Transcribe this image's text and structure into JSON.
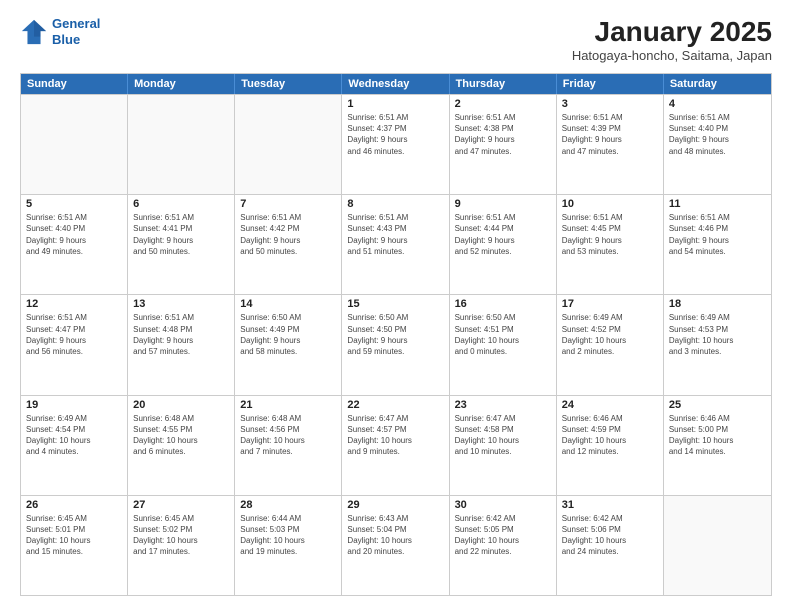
{
  "header": {
    "logo_line1": "General",
    "logo_line2": "Blue",
    "main_title": "January 2025",
    "subtitle": "Hatogaya-honcho, Saitama, Japan"
  },
  "weekdays": [
    "Sunday",
    "Monday",
    "Tuesday",
    "Wednesday",
    "Thursday",
    "Friday",
    "Saturday"
  ],
  "weeks": [
    [
      {
        "day": "",
        "info": ""
      },
      {
        "day": "",
        "info": ""
      },
      {
        "day": "",
        "info": ""
      },
      {
        "day": "1",
        "info": "Sunrise: 6:51 AM\nSunset: 4:37 PM\nDaylight: 9 hours\nand 46 minutes."
      },
      {
        "day": "2",
        "info": "Sunrise: 6:51 AM\nSunset: 4:38 PM\nDaylight: 9 hours\nand 47 minutes."
      },
      {
        "day": "3",
        "info": "Sunrise: 6:51 AM\nSunset: 4:39 PM\nDaylight: 9 hours\nand 47 minutes."
      },
      {
        "day": "4",
        "info": "Sunrise: 6:51 AM\nSunset: 4:40 PM\nDaylight: 9 hours\nand 48 minutes."
      }
    ],
    [
      {
        "day": "5",
        "info": "Sunrise: 6:51 AM\nSunset: 4:40 PM\nDaylight: 9 hours\nand 49 minutes."
      },
      {
        "day": "6",
        "info": "Sunrise: 6:51 AM\nSunset: 4:41 PM\nDaylight: 9 hours\nand 50 minutes."
      },
      {
        "day": "7",
        "info": "Sunrise: 6:51 AM\nSunset: 4:42 PM\nDaylight: 9 hours\nand 50 minutes."
      },
      {
        "day": "8",
        "info": "Sunrise: 6:51 AM\nSunset: 4:43 PM\nDaylight: 9 hours\nand 51 minutes."
      },
      {
        "day": "9",
        "info": "Sunrise: 6:51 AM\nSunset: 4:44 PM\nDaylight: 9 hours\nand 52 minutes."
      },
      {
        "day": "10",
        "info": "Sunrise: 6:51 AM\nSunset: 4:45 PM\nDaylight: 9 hours\nand 53 minutes."
      },
      {
        "day": "11",
        "info": "Sunrise: 6:51 AM\nSunset: 4:46 PM\nDaylight: 9 hours\nand 54 minutes."
      }
    ],
    [
      {
        "day": "12",
        "info": "Sunrise: 6:51 AM\nSunset: 4:47 PM\nDaylight: 9 hours\nand 56 minutes."
      },
      {
        "day": "13",
        "info": "Sunrise: 6:51 AM\nSunset: 4:48 PM\nDaylight: 9 hours\nand 57 minutes."
      },
      {
        "day": "14",
        "info": "Sunrise: 6:50 AM\nSunset: 4:49 PM\nDaylight: 9 hours\nand 58 minutes."
      },
      {
        "day": "15",
        "info": "Sunrise: 6:50 AM\nSunset: 4:50 PM\nDaylight: 9 hours\nand 59 minutes."
      },
      {
        "day": "16",
        "info": "Sunrise: 6:50 AM\nSunset: 4:51 PM\nDaylight: 10 hours\nand 0 minutes."
      },
      {
        "day": "17",
        "info": "Sunrise: 6:49 AM\nSunset: 4:52 PM\nDaylight: 10 hours\nand 2 minutes."
      },
      {
        "day": "18",
        "info": "Sunrise: 6:49 AM\nSunset: 4:53 PM\nDaylight: 10 hours\nand 3 minutes."
      }
    ],
    [
      {
        "day": "19",
        "info": "Sunrise: 6:49 AM\nSunset: 4:54 PM\nDaylight: 10 hours\nand 4 minutes."
      },
      {
        "day": "20",
        "info": "Sunrise: 6:48 AM\nSunset: 4:55 PM\nDaylight: 10 hours\nand 6 minutes."
      },
      {
        "day": "21",
        "info": "Sunrise: 6:48 AM\nSunset: 4:56 PM\nDaylight: 10 hours\nand 7 minutes."
      },
      {
        "day": "22",
        "info": "Sunrise: 6:47 AM\nSunset: 4:57 PM\nDaylight: 10 hours\nand 9 minutes."
      },
      {
        "day": "23",
        "info": "Sunrise: 6:47 AM\nSunset: 4:58 PM\nDaylight: 10 hours\nand 10 minutes."
      },
      {
        "day": "24",
        "info": "Sunrise: 6:46 AM\nSunset: 4:59 PM\nDaylight: 10 hours\nand 12 minutes."
      },
      {
        "day": "25",
        "info": "Sunrise: 6:46 AM\nSunset: 5:00 PM\nDaylight: 10 hours\nand 14 minutes."
      }
    ],
    [
      {
        "day": "26",
        "info": "Sunrise: 6:45 AM\nSunset: 5:01 PM\nDaylight: 10 hours\nand 15 minutes."
      },
      {
        "day": "27",
        "info": "Sunrise: 6:45 AM\nSunset: 5:02 PM\nDaylight: 10 hours\nand 17 minutes."
      },
      {
        "day": "28",
        "info": "Sunrise: 6:44 AM\nSunset: 5:03 PM\nDaylight: 10 hours\nand 19 minutes."
      },
      {
        "day": "29",
        "info": "Sunrise: 6:43 AM\nSunset: 5:04 PM\nDaylight: 10 hours\nand 20 minutes."
      },
      {
        "day": "30",
        "info": "Sunrise: 6:42 AM\nSunset: 5:05 PM\nDaylight: 10 hours\nand 22 minutes."
      },
      {
        "day": "31",
        "info": "Sunrise: 6:42 AM\nSunset: 5:06 PM\nDaylight: 10 hours\nand 24 minutes."
      },
      {
        "day": "",
        "info": ""
      }
    ]
  ]
}
